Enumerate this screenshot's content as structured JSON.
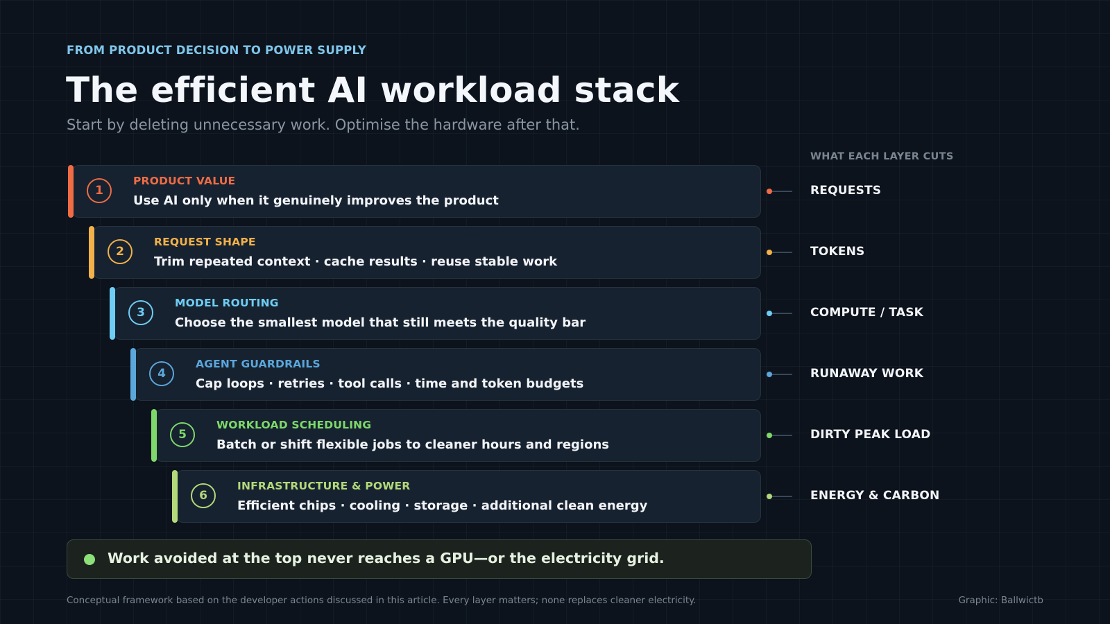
{
  "header": {
    "eyebrow": "FROM PRODUCT DECISION TO POWER SUPPLY",
    "title": "The efficient AI workload stack",
    "subtitle": "Start by deleting unnecessary work. Optimise the hardware after that."
  },
  "cuts_header": "WHAT EACH LAYER CUTS",
  "layers": [
    {
      "number": "1",
      "name": "PRODUCT VALUE",
      "description": "Use AI only when it genuinely improves the product",
      "cut": "REQUESTS",
      "color": "#ef6c45"
    },
    {
      "number": "2",
      "name": "REQUEST SHAPE",
      "description": "Trim repeated context · cache results · reuse stable work",
      "cut": "TOKENS",
      "color": "#f2b14a"
    },
    {
      "number": "3",
      "name": "MODEL ROUTING",
      "description": "Choose the smallest model that still meets the quality bar",
      "cut": "COMPUTE / TASK",
      "color": "#6fcdf5"
    },
    {
      "number": "4",
      "name": "AGENT GUARDRAILS",
      "description": "Cap loops · retries · tool calls · time and token budgets",
      "cut": "RUNAWAY WORK",
      "color": "#5ba6db"
    },
    {
      "number": "5",
      "name": "WORKLOAD SCHEDULING",
      "description": "Batch or shift flexible jobs to cleaner hours and regions",
      "cut": "DIRTY PEAK LOAD",
      "color": "#7ed96a"
    },
    {
      "number": "6",
      "name": "INFRASTRUCTURE & POWER",
      "description": "Efficient chips · cooling · storage · additional clean energy",
      "cut": "ENERGY & CARBON",
      "color": "#b3d97a"
    }
  ],
  "callout": "Work avoided at the top never reaches a GPU—or the electricity grid.",
  "footnote": "Conceptual framework based on the developer actions discussed in this article. Every layer matters; none replaces cleaner electricity.",
  "credit": "Graphic: Ballwictb"
}
